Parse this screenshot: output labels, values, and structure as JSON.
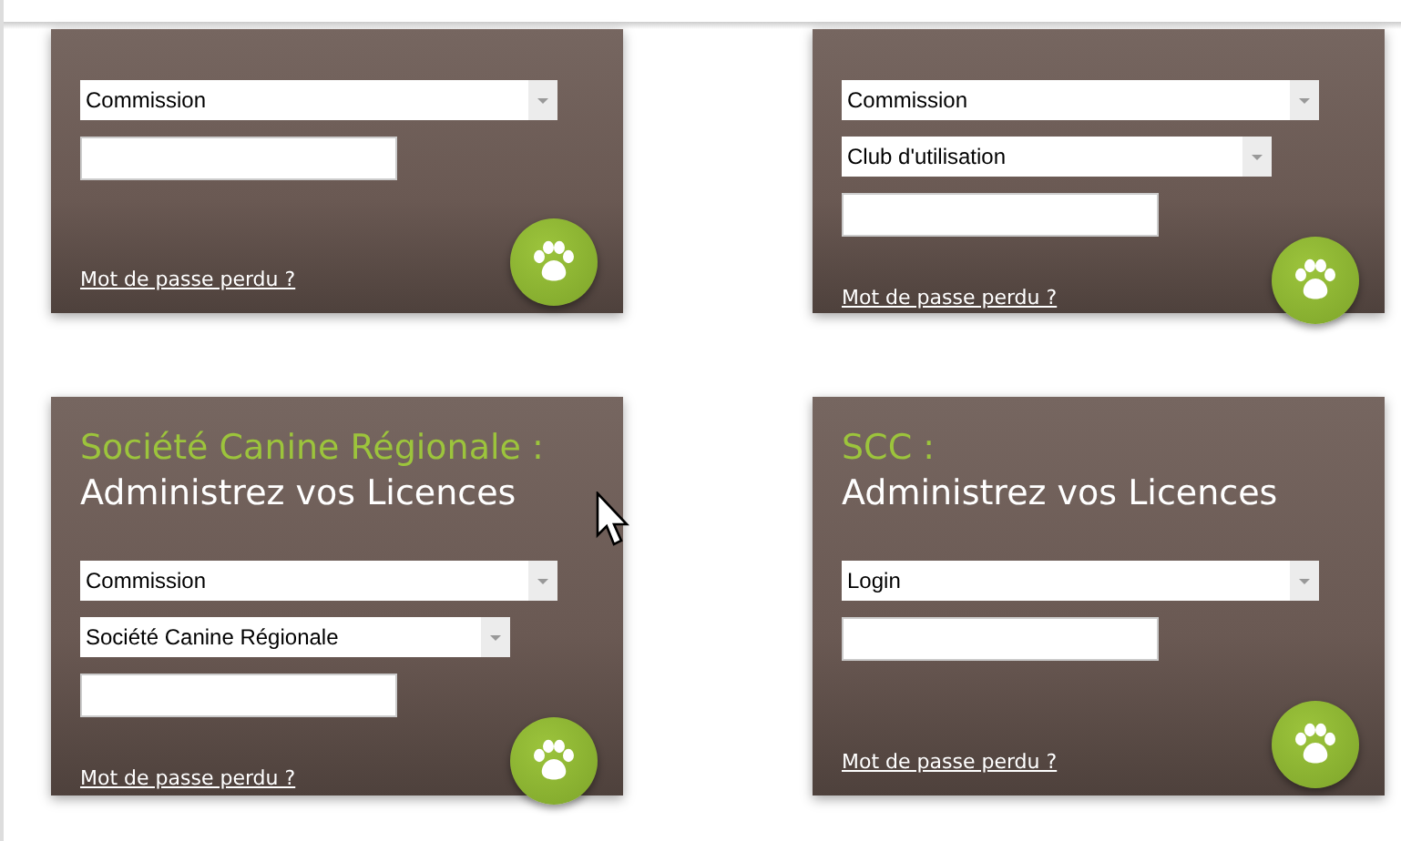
{
  "cards": [
    {
      "selects": [
        {
          "value": "Commission"
        }
      ],
      "link": "Mot de passe perdu ?"
    },
    {
      "selects": [
        {
          "value": "Commission"
        },
        {
          "value": "Club d'utilisation"
        }
      ],
      "link": "Mot de passe perdu ?"
    },
    {
      "title": "Société Canine Régionale :",
      "heading": "Administrez vos Licences",
      "selects": [
        {
          "value": "Commission"
        },
        {
          "value": "Société Canine Régionale"
        }
      ],
      "link": "Mot de passe perdu ?"
    },
    {
      "title": "SCC :",
      "heading": "Administrez vos Licences",
      "selects": [
        {
          "value": "Login"
        }
      ],
      "link": "Mot de passe perdu ?"
    }
  ]
}
